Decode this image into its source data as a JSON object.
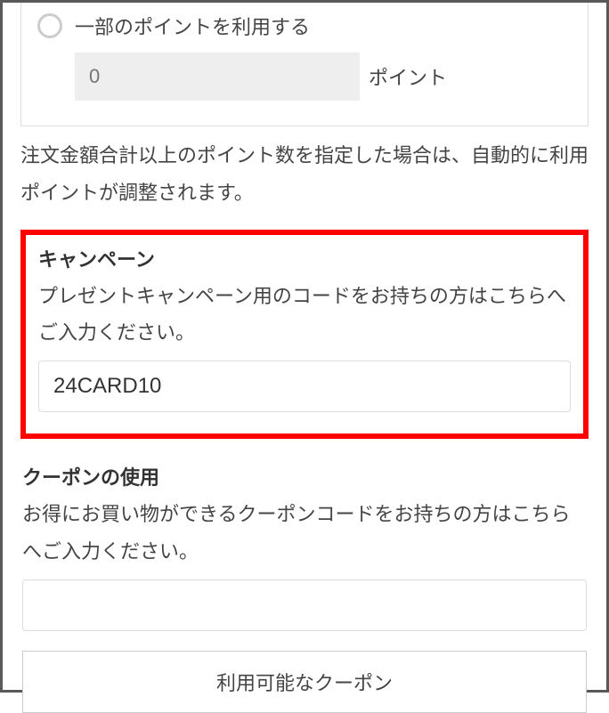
{
  "points": {
    "partial_label": "一部のポイントを利用する",
    "input_placeholder": "0",
    "suffix": "ポイント",
    "note": "注文金額合計以上のポイント数を指定した場合は、自動的に利用ポイントが調整されます。"
  },
  "campaign": {
    "title": "キャンペーン",
    "desc": "プレゼントキャンペーン用のコードをお持ちの方はこちらへご入力ください。",
    "value": "24CARD10"
  },
  "coupon": {
    "title": "クーポンの使用",
    "desc": "お得にお買い物ができるクーポンコードをお持ちの方はこちらへご入力ください。",
    "value": "",
    "button": "利用可能なクーポン"
  }
}
